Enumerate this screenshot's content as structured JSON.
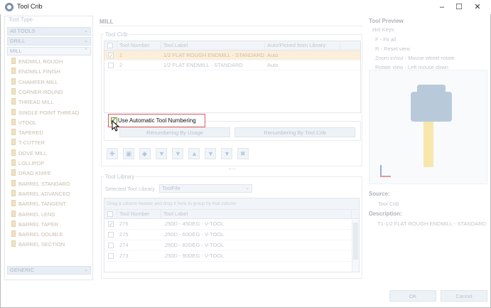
{
  "window": {
    "title": "Tool Crib"
  },
  "left": {
    "legend": "Tool Type",
    "categories": {
      "all": "All TOOLS",
      "drill": "DRILL",
      "mill": "MILL",
      "generic": "GENERIC"
    },
    "tools": [
      "ENDMILL ROUGH",
      "ENDMILL FINISH",
      "CHAMFER MILL",
      "CORNER-ROUND",
      "THREAD MILL",
      "SINGLE POINT THREAD",
      "VTOOL",
      "TAPERED",
      "T-CUTTER",
      "DOVE MILL",
      "LOLLIPOP",
      "DRAG KNIFE",
      "BARREL STANDARD",
      "BARREL ADVANCED",
      "BARREL TANGENT",
      "BARREL LENS",
      "BARREL TAPER",
      "BARREL DOUBLE",
      "BARREL SECTION"
    ]
  },
  "mill": {
    "header": "MILL",
    "crib_legend": "Tool Crib",
    "columns": [
      "Tool Number",
      "Tool Label",
      "Auto/Picked from Library"
    ],
    "rows": [
      {
        "num": "1",
        "label": "1/2 FLAT ROUGH ENDMILL - STANDARD",
        "auto": "Auto"
      },
      {
        "num": "2",
        "label": "1/2 FLAT ENDMILL - STANDARD",
        "auto": "Auto"
      }
    ],
    "auto_numbering_label": "Use Automatic Tool Numbering",
    "renumber_usage": "Renumbering By Usage",
    "renumber_crib": "Renumbering By Tool Crib"
  },
  "library": {
    "legend": "Tool Library",
    "selected_label": "Selected Tool Library",
    "selected_value": "ToolFile",
    "group_hint": "Drag a column header and drop it here to group by that column",
    "columns": [
      "Tool Number",
      "Tool Label"
    ],
    "rows": [
      {
        "num": "276",
        "label": ".250D - 45DEG - V-TOOL"
      },
      {
        "num": "275",
        "label": ".250D - 60DEG - V-TOOL"
      },
      {
        "num": "274",
        "label": ".250D - 82DEG - V-TOOL"
      },
      {
        "num": "273",
        "label": ".250D - 90DEG - V-TOOL"
      }
    ]
  },
  "preview": {
    "title": "Tool Preview",
    "hotkeys_label": "Hot Keys:",
    "hotkeys": [
      "F - Fit all",
      "R - Reset view",
      "Zoom in/out - Mouse wheel rotate",
      "Rotate view - Left mouse down"
    ],
    "source_label": "Source:",
    "source_value": "Tool Crib",
    "description_label": "Description:",
    "description_value": "T1-1/2 FLAT ROUGH ENDMILL - STANDARD"
  },
  "footer": {
    "ok": "OK",
    "cancel": "Cancel"
  }
}
